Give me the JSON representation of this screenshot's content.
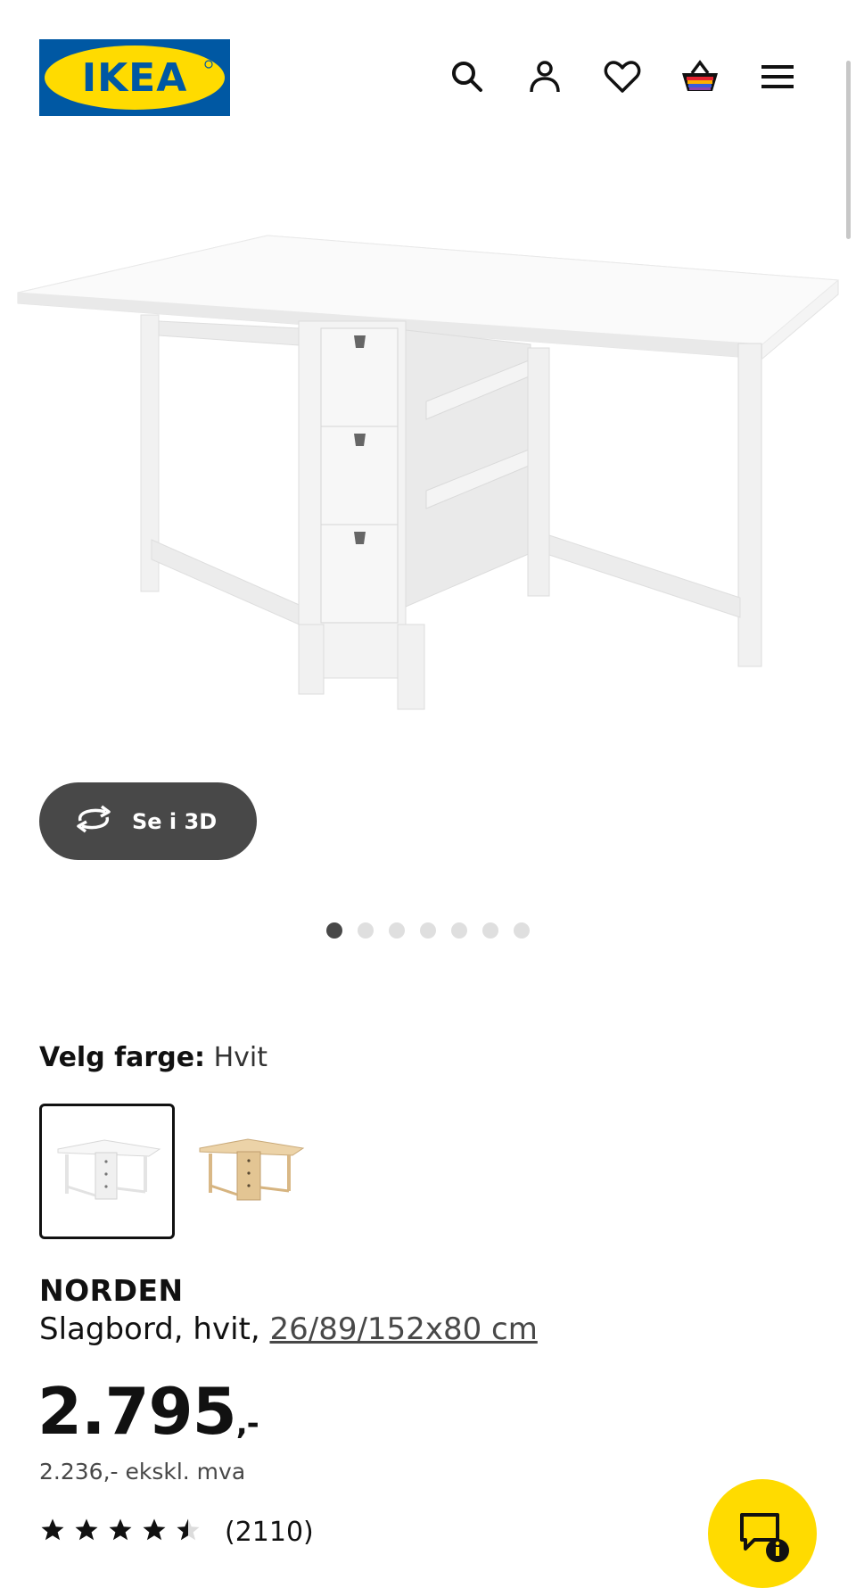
{
  "brand": {
    "logo_text": "IKEA",
    "logo_bg": "#0058a3",
    "logo_yellow": "#ffdb00"
  },
  "header": {
    "icons": [
      "search-icon",
      "user-icon",
      "heart-icon",
      "basket-icon",
      "menu-icon"
    ]
  },
  "gallery": {
    "view_3d_label": "Se i 3D",
    "slide_count": 7,
    "active_slide": 1
  },
  "color_select": {
    "label": "Velg farge:",
    "value": "Hvit",
    "options": [
      "white-table-swatch",
      "birch-table-swatch"
    ]
  },
  "product": {
    "name": "NORDEN",
    "description": "Slagbord, hvit,",
    "size_link": "26/89/152x80 cm",
    "price_main": "2.795",
    "price_suffix": ",-",
    "price_ex_vat": "2.236,- ekskl. mva",
    "rating_value": 4.5,
    "rating_count": "(2110)"
  },
  "colors": {
    "accent_yellow": "#ffdb00",
    "dark_grey": "#484848",
    "dot_inactive": "#dfdfdf"
  }
}
